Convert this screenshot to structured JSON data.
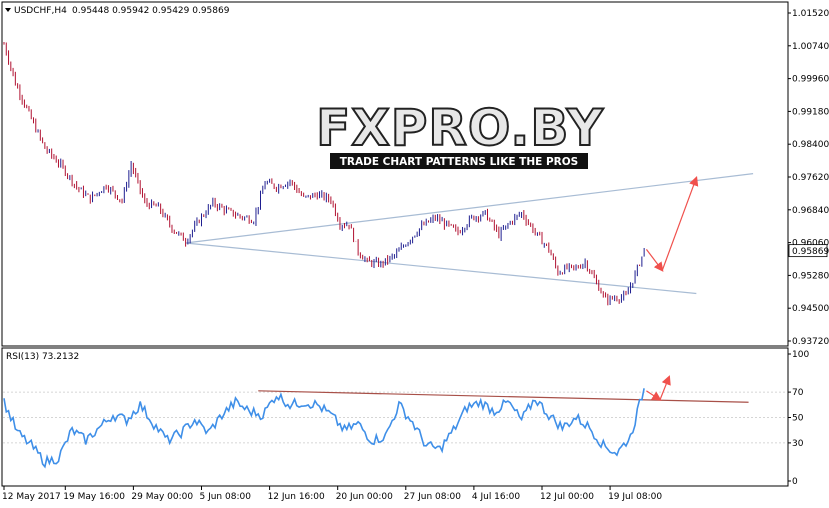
{
  "header": {
    "symbol": "USDCHF,H4",
    "ohlc": "0.95448 0.95942 0.95429 0.95869"
  },
  "watermark": {
    "brand": "FXPRO.BY",
    "tagline": "TRADE CHART PATTERNS LIKE THE PROS"
  },
  "colors": {
    "bull_candle": "#1e1e90",
    "bear_candle": "#b01030",
    "channel_line": "#a8bcd4",
    "forecast_arrow": "#f0504c",
    "rsi_line": "#3f8fe8",
    "rsi_trendline": "#a85048",
    "frame": "#000000"
  },
  "chart_data": [
    {
      "type": "candlestick",
      "symbol": "USDCHF",
      "timeframe": "H4",
      "ylim": [
        0.9372,
        1.0152
      ],
      "y_ticks": [
        "1.01520",
        "1.00740",
        "0.99960",
        "0.99180",
        "0.98400",
        "0.97620",
        "0.96840",
        "0.96060",
        "0.95280",
        "0.94500",
        "0.93720"
      ],
      "last_price": "0.95869",
      "x_ticks": [
        "12 May 2017",
        "19 May 16:00",
        "29 May 00:00",
        "5 Jun 08:00",
        "12 Jun 16:00",
        "20 Jun 00:00",
        "27 Jun 08:00",
        "4 Jul 16:00",
        "12 Jul 00:00",
        "19 Jul 08:00"
      ],
      "path_anchors": [
        {
          "i": 0,
          "c": 1.0078
        },
        {
          "i": 5,
          "c": 0.9985
        },
        {
          "i": 12,
          "c": 0.99
        },
        {
          "i": 18,
          "c": 0.983
        },
        {
          "i": 25,
          "c": 0.979
        },
        {
          "i": 32,
          "c": 0.9738
        },
        {
          "i": 38,
          "c": 0.971
        },
        {
          "i": 45,
          "c": 0.9742
        },
        {
          "i": 52,
          "c": 0.9705
        },
        {
          "i": 56,
          "c": 0.9792
        },
        {
          "i": 62,
          "c": 0.97
        },
        {
          "i": 68,
          "c": 0.969
        },
        {
          "i": 74,
          "c": 0.964
        },
        {
          "i": 80,
          "c": 0.961
        },
        {
          "i": 86,
          "c": 0.966
        },
        {
          "i": 92,
          "c": 0.97
        },
        {
          "i": 98,
          "c": 0.9682
        },
        {
          "i": 104,
          "c": 0.9668
        },
        {
          "i": 110,
          "c": 0.966
        },
        {
          "i": 115,
          "c": 0.975
        },
        {
          "i": 120,
          "c": 0.9738
        },
        {
          "i": 126,
          "c": 0.9752
        },
        {
          "i": 132,
          "c": 0.9712
        },
        {
          "i": 138,
          "c": 0.972
        },
        {
          "i": 144,
          "c": 0.9708
        },
        {
          "i": 148,
          "c": 0.965
        },
        {
          "i": 152,
          "c": 0.965
        },
        {
          "i": 156,
          "c": 0.9585
        },
        {
          "i": 160,
          "c": 0.956
        },
        {
          "i": 166,
          "c": 0.9555
        },
        {
          "i": 172,
          "c": 0.9575
        },
        {
          "i": 178,
          "c": 0.961
        },
        {
          "i": 184,
          "c": 0.9645
        },
        {
          "i": 190,
          "c": 0.9665
        },
        {
          "i": 196,
          "c": 0.9645
        },
        {
          "i": 200,
          "c": 0.963
        },
        {
          "i": 206,
          "c": 0.9665
        },
        {
          "i": 212,
          "c": 0.9675
        },
        {
          "i": 218,
          "c": 0.9625
        },
        {
          "i": 224,
          "c": 0.966
        },
        {
          "i": 228,
          "c": 0.9676
        },
        {
          "i": 234,
          "c": 0.963
        },
        {
          "i": 240,
          "c": 0.959
        },
        {
          "i": 244,
          "c": 0.9535
        },
        {
          "i": 248,
          "c": 0.9545
        },
        {
          "i": 252,
          "c": 0.9545
        },
        {
          "i": 256,
          "c": 0.956
        },
        {
          "i": 260,
          "c": 0.952
        },
        {
          "i": 265,
          "c": 0.947
        },
        {
          "i": 270,
          "c": 0.9475
        },
        {
          "i": 274,
          "c": 0.9478
        },
        {
          "i": 278,
          "c": 0.953
        },
        {
          "i": 282,
          "c": 0.9587
        }
      ],
      "candle_count": 283,
      "channel_upper": [
        {
          "i": 80,
          "c": 0.9605
        },
        {
          "i": 330,
          "c": 0.977
        }
      ],
      "channel_lower": [
        {
          "i": 80,
          "c": 0.9605
        },
        {
          "i": 305,
          "c": 0.9485
        }
      ],
      "forecast_arrows": [
        {
          "from": {
            "i": 283,
            "c": 0.959
          },
          "to": {
            "i": 290,
            "c": 0.954
          }
        },
        {
          "from": {
            "i": 290,
            "c": 0.954
          },
          "to": {
            "i": 305,
            "c": 0.976
          }
        }
      ]
    },
    {
      "type": "line",
      "title": "RSI(13) 73.2132",
      "ylim": [
        0,
        100
      ],
      "y_ticks": [
        "100",
        "70",
        "50",
        "30",
        "0"
      ],
      "levels": [
        70,
        50,
        30
      ],
      "rsi_anchors": [
        {
          "i": 0,
          "v": 62
        },
        {
          "i": 6,
          "v": 38
        },
        {
          "i": 12,
          "v": 28
        },
        {
          "i": 18,
          "v": 15
        },
        {
          "i": 24,
          "v": 18
        },
        {
          "i": 30,
          "v": 40
        },
        {
          "i": 36,
          "v": 32
        },
        {
          "i": 42,
          "v": 42
        },
        {
          "i": 48,
          "v": 52
        },
        {
          "i": 54,
          "v": 48
        },
        {
          "i": 60,
          "v": 60
        },
        {
          "i": 66,
          "v": 45
        },
        {
          "i": 72,
          "v": 32
        },
        {
          "i": 78,
          "v": 38
        },
        {
          "i": 84,
          "v": 48
        },
        {
          "i": 90,
          "v": 38
        },
        {
          "i": 96,
          "v": 52
        },
        {
          "i": 102,
          "v": 62
        },
        {
          "i": 108,
          "v": 55
        },
        {
          "i": 114,
          "v": 52
        },
        {
          "i": 120,
          "v": 68
        },
        {
          "i": 126,
          "v": 60
        },
        {
          "i": 132,
          "v": 62
        },
        {
          "i": 138,
          "v": 60
        },
        {
          "i": 144,
          "v": 52
        },
        {
          "i": 150,
          "v": 40
        },
        {
          "i": 156,
          "v": 45
        },
        {
          "i": 162,
          "v": 32
        },
        {
          "i": 168,
          "v": 35
        },
        {
          "i": 174,
          "v": 60
        },
        {
          "i": 180,
          "v": 46
        },
        {
          "i": 186,
          "v": 28
        },
        {
          "i": 192,
          "v": 25
        },
        {
          "i": 198,
          "v": 40
        },
        {
          "i": 204,
          "v": 58
        },
        {
          "i": 210,
          "v": 62
        },
        {
          "i": 216,
          "v": 55
        },
        {
          "i": 222,
          "v": 62
        },
        {
          "i": 228,
          "v": 48
        },
        {
          "i": 234,
          "v": 65
        },
        {
          "i": 240,
          "v": 52
        },
        {
          "i": 246,
          "v": 42
        },
        {
          "i": 252,
          "v": 50
        },
        {
          "i": 258,
          "v": 42
        },
        {
          "i": 264,
          "v": 28
        },
        {
          "i": 270,
          "v": 22
        },
        {
          "i": 276,
          "v": 35
        },
        {
          "i": 282,
          "v": 73
        }
      ],
      "trendline": [
        {
          "i": 112,
          "v": 71
        },
        {
          "i": 328,
          "v": 62
        }
      ],
      "forecast_arrows": [
        {
          "from": {
            "i": 283,
            "v": 71
          },
          "to": {
            "i": 289,
            "v": 64
          }
        },
        {
          "from": {
            "i": 289,
            "v": 64
          },
          "to": {
            "i": 293,
            "v": 82
          }
        }
      ]
    }
  ]
}
